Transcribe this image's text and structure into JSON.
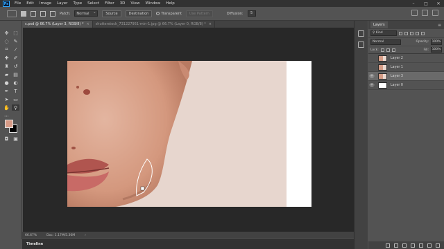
{
  "menu": {
    "logo": "Ps",
    "items": [
      "File",
      "Edit",
      "Image",
      "Layer",
      "Type",
      "Select",
      "Filter",
      "3D",
      "View",
      "Window",
      "Help"
    ]
  },
  "options": {
    "patch_label": "Patch:",
    "patch_value": "Normal",
    "source_label": "Source",
    "destination_label": "Destination",
    "transparent_label": "Transparent",
    "use_pattern_label": "Use Pattern",
    "diffusion_label": "Diffusion:",
    "diffusion_value": "5"
  },
  "tabs": [
    {
      "label": "c.psd @ 66.7% (Layer 3, RGB/8) *",
      "close": "×"
    },
    {
      "label": "shutterstock_731227951-min-1.jpg @ 66.7% (Layer 0, RGB/8) *",
      "close": "×"
    }
  ],
  "status": {
    "zoom": "66.67%",
    "doc": "Doc: 1.17M/5.36M",
    "arrow": "›"
  },
  "timeline": {
    "label": "Timeline"
  },
  "tools": [
    "move-icon",
    "artboard-icon",
    "lasso-icon",
    "quick-select-icon",
    "crop-icon",
    "eyedropper-icon",
    "healing-icon",
    "brush-icon",
    "clone-stamp-icon",
    "history-brush-icon",
    "eraser-icon",
    "gradient-icon",
    "blur-icon",
    "dodge-icon",
    "pen-icon",
    "type-icon",
    "path-select-icon",
    "rectangle-icon",
    "hand-icon",
    "zoom-icon",
    "edit-toolbar-icon"
  ],
  "colors": {
    "foreground": "#d69a86",
    "background": "#000000",
    "skin": "#e7d6ce"
  },
  "layers_panel": {
    "title": "Layers",
    "kind_label": "Kind",
    "blend_mode": "Normal",
    "opacity_label": "Opacity:",
    "opacity_value": "100%",
    "lock_label": "Lock:",
    "fill_label": "Fill:",
    "fill_value": "100%",
    "layers": [
      {
        "name": "Layer 2",
        "visible": false,
        "selected": false
      },
      {
        "name": "Layer 1",
        "visible": false,
        "selected": false
      },
      {
        "name": "Layer 3",
        "visible": true,
        "selected": true
      },
      {
        "name": "Layer 0",
        "visible": true,
        "selected": false
      }
    ]
  }
}
